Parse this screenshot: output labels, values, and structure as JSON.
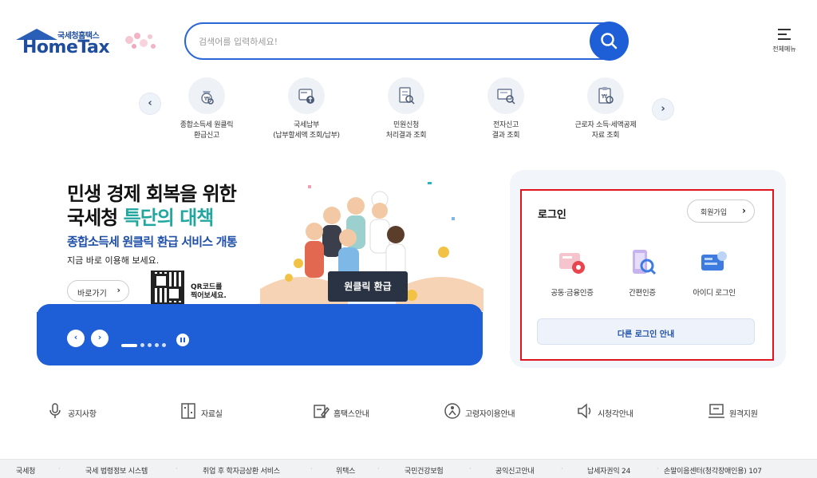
{
  "header": {
    "logo_sub": "국세청홈택스",
    "logo_name": "HomeTax",
    "search_placeholder": "검색어를 입력하세요!",
    "menu_label": "전체메뉴"
  },
  "quick_menu": [
    {
      "line1": "종합소득세 원클릭",
      "line2": "환급신고",
      "icon": "tax-refund-icon"
    },
    {
      "line1": "국세납부",
      "line2": "(납부할세액 조회/납부)",
      "icon": "tax-payment-icon"
    },
    {
      "line1": "민원신청",
      "line2": "처리결과 조회",
      "icon": "civil-petition-icon"
    },
    {
      "line1": "전자신고",
      "line2": "결과 조회",
      "icon": "e-filing-icon"
    },
    {
      "line1": "근로자 소득·세액공제",
      "line2": "자료 조회",
      "icon": "deduction-doc-icon"
    }
  ],
  "banner": {
    "headline_1": "민생 경제 회복을 위한",
    "headline_2a": "국세청 ",
    "headline_2b": "특단의 대책",
    "subhead": "종합소득세 원클릭 환급 서비스 개통",
    "desc": "지금 바로 이용해 보세요.",
    "go_label": "바로가기",
    "qr_line1": "QR코드를",
    "qr_line2": "찍어보세요.",
    "slogan": "원클릭 환급"
  },
  "login": {
    "title": "로그인",
    "join_label": "회원가입",
    "options": [
      {
        "label": "공동·금융인증",
        "icon": "certificate-icon"
      },
      {
        "label": "간편인증",
        "icon": "simple-auth-icon"
      },
      {
        "label": "아이디 로그인",
        "icon": "id-login-icon"
      }
    ],
    "other_label": "다른 로그인 안내"
  },
  "shortcuts": [
    {
      "label": "공지사항",
      "icon": "microphone-icon"
    },
    {
      "label": "자료실",
      "icon": "archive-icon"
    },
    {
      "label": "홈택스안내",
      "icon": "guide-icon"
    },
    {
      "label": "고령자이용안내",
      "icon": "senior-icon"
    },
    {
      "label": "시청각안내",
      "icon": "speaker-icon"
    },
    {
      "label": "원격지원",
      "icon": "remote-support-icon"
    }
  ],
  "footer": [
    "국세청",
    "국세 법령정보 시스템",
    "취업 후 학자금상환 서비스",
    "위택스",
    "국민건강보험",
    "공익신고안내",
    "납세자권익 24",
    "손말이음센터(청각장애인용) 107"
  ],
  "colors": {
    "brand_blue": "#1e5ed6",
    "highlight_teal": "#22a7a0",
    "login_border_red": "#e0141e"
  }
}
